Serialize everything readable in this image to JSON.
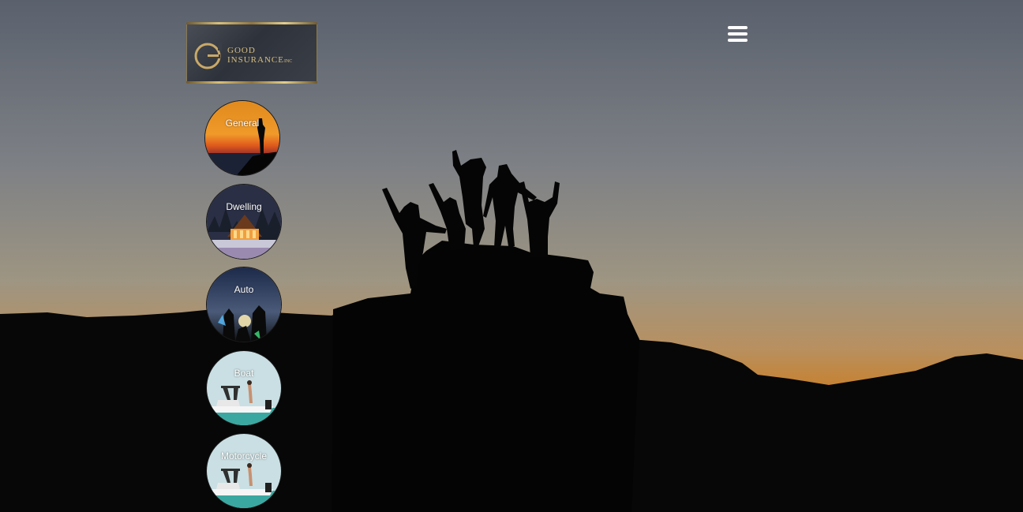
{
  "brand": {
    "line1": "GOOD",
    "line2": "INSURANCE",
    "suffix": "INC",
    "gold": "#d7bf80"
  },
  "nav": {
    "menu_icon": "hamburger-menu-icon"
  },
  "categories": [
    {
      "label": "General"
    },
    {
      "label": "Dwelling"
    },
    {
      "label": "Auto"
    },
    {
      "label": "Boat"
    },
    {
      "label": "Motorcycle"
    }
  ],
  "colors": {
    "sky_top": "#5d6470",
    "sky_mid": "#8a8a88",
    "horizon": "#c9883c",
    "silhouette": "#050505"
  }
}
